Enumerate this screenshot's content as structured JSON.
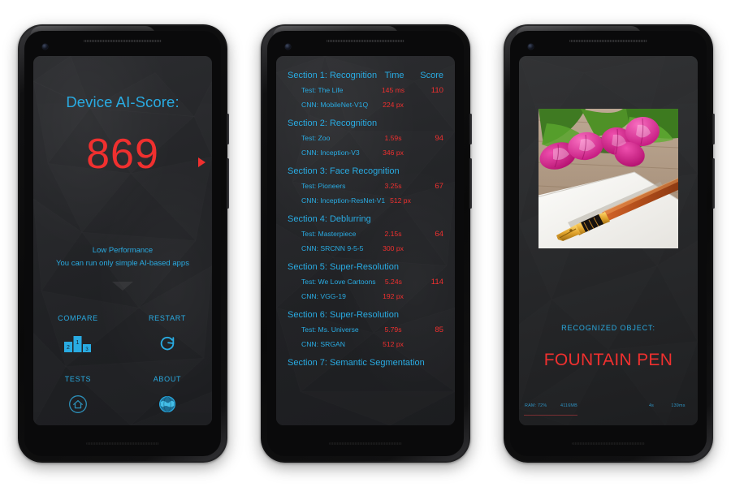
{
  "app": {
    "accent_cyan": "#29abe2",
    "accent_red": "#f0302f",
    "screen_bg": "#242527"
  },
  "phone1": {
    "title": "Device AI-Score:",
    "score": "869",
    "play_arrow_icon": "play-triangle-icon",
    "performance_label": "Low Performance",
    "performance_sub": "You can run only simple AI-based apps",
    "actions": [
      {
        "label": "COMPARE",
        "icon": "podium-icon",
        "podium": [
          "2",
          "1",
          "3"
        ]
      },
      {
        "label": "RESTART",
        "icon": "refresh-icon"
      },
      {
        "label": "TESTS",
        "icon": "home-icon"
      },
      {
        "label": "ABOUT",
        "icon": "globe-icon"
      }
    ]
  },
  "phone2": {
    "columns": {
      "time": "Time",
      "score": "Score"
    },
    "sections": [
      {
        "title": "Section 1: Recognition",
        "show_columns": true,
        "rows": [
          {
            "label": "Test: The Life",
            "time": "145 ms",
            "score": "110"
          },
          {
            "label": "CNN: MobileNet-V1Q",
            "time": "224 px",
            "score": ""
          }
        ]
      },
      {
        "title": "Section 2: Recognition",
        "show_columns": false,
        "rows": [
          {
            "label": "Test: Zoo",
            "time": "1.59s",
            "score": "94"
          },
          {
            "label": "CNN: Inception-V3",
            "time": "346 px",
            "score": ""
          }
        ]
      },
      {
        "title": "Section 3: Face Recognition",
        "show_columns": false,
        "rows": [
          {
            "label": "Test: Pioneers",
            "time": "3.25s",
            "score": "67"
          },
          {
            "label": "CNN: Inception-ResNet-V1",
            "time": "512 px",
            "score": ""
          }
        ]
      },
      {
        "title": "Section 4: Deblurring",
        "show_columns": false,
        "rows": [
          {
            "label": "Test: Masterpiece",
            "time": "2.15s",
            "score": "64"
          },
          {
            "label": "CNN: SRCNN 9-5-5",
            "time": "300 px",
            "score": ""
          }
        ]
      },
      {
        "title": "Section 5: Super-Resolution",
        "show_columns": false,
        "rows": [
          {
            "label": "Test: We Love Cartoons",
            "time": "5.24s",
            "score": "114"
          },
          {
            "label": "CNN: VGG-19",
            "time": "192 px",
            "score": ""
          }
        ]
      },
      {
        "title": "Section 6: Super-Resolution",
        "show_columns": false,
        "rows": [
          {
            "label": "Test: Ms. Universe",
            "time": "5.79s",
            "score": "85"
          },
          {
            "label": "CNN: SRGAN",
            "time": "512 px",
            "score": ""
          }
        ]
      },
      {
        "title": "Section 7: Semantic Segmentation",
        "show_columns": false,
        "rows": []
      }
    ]
  },
  "phone3": {
    "photo_alt": "fountain-pen-and-tulips-photo",
    "recognized_label": "RECOGNIZED OBJECT:",
    "recognized_object": "FOUNTAIN PEN",
    "status": {
      "ram": "RAM: 72%",
      "memory": "4116MB",
      "duration": "4s",
      "latency": "139ms"
    }
  }
}
